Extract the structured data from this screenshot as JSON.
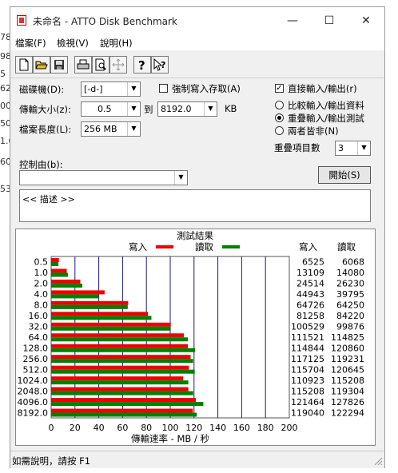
{
  "left_strip_numbers": [
    "78",
    "98",
    "5",
    "62",
    "00",
    "50",
    "1.0",
    "60",
    "53"
  ],
  "window": {
    "title": "未命名 - ATTO Disk Benchmark",
    "controls": {
      "minimize": "—",
      "maximize": "☐",
      "close": "✕"
    }
  },
  "menu": [
    "檔案(F)",
    "檢視(V)",
    "說明(H)"
  ],
  "toolbar_icons": [
    "new-icon",
    "open-icon",
    "save-icon",
    "print-icon",
    "print-preview-icon",
    "move-icon",
    "help-icon",
    "context-help-icon"
  ],
  "form": {
    "drive_label": "磁碟機(D):",
    "drive_value": "[-d-]",
    "force_write_label": "強制寫入存取(A)",
    "force_write_checked": false,
    "direct_io_label": "直接輸入/輸出(r)",
    "direct_io_checked": true,
    "transfer_label": "傳輸大小(z):",
    "transfer_from": "0.5",
    "to_label": "到",
    "transfer_to": "8192.0",
    "kb_label": "KB",
    "length_label": "檔案長度(L):",
    "length_value": "256 MB",
    "radio_compare": "比較輸入/輸出資料",
    "radio_overlap": "重疊輸入/輸出測試",
    "radio_neither": "兩者皆非(N)",
    "selected_radio": "radio_overlap",
    "queue_label": "重疊項目數",
    "queue_value": "3",
    "controlled_by_label": "控制由(b):",
    "controlled_by_value": "",
    "start_button": "開始(S)",
    "description": "<< 描述 >>"
  },
  "results": {
    "title": "測試結果",
    "legend_write": "寫入",
    "legend_read": "讀取",
    "col_write": "寫入",
    "col_read": "讀取",
    "write_values": [
      "6525",
      "13109",
      "24514",
      "44943",
      "64726",
      "81258",
      "100529",
      "111521",
      "114844",
      "117125",
      "115704",
      "110923",
      "115208",
      "121464",
      "119040"
    ],
    "read_values": [
      "6068",
      "14080",
      "26230",
      "39795",
      "64250",
      "84220",
      "99876",
      "114825",
      "120860",
      "119231",
      "120645",
      "115208",
      "119304",
      "127826",
      "122294"
    ]
  },
  "chart_data": {
    "type": "bar",
    "orientation": "horizontal",
    "categories": [
      "0.5",
      "1.0",
      "2.0",
      "4.0",
      "8.0",
      "16.0",
      "32.0",
      "64.0",
      "128.0",
      "256.0",
      "512.0",
      "1024.0",
      "2048.0",
      "4096.0",
      "8192.0"
    ],
    "series": [
      {
        "name": "寫入",
        "color": "#ee0000",
        "values": [
          6.5,
          13.1,
          24.5,
          44.9,
          64.7,
          81.3,
          100.5,
          111.5,
          114.8,
          117.1,
          115.7,
          110.9,
          115.2,
          121.5,
          119.0
        ]
      },
      {
        "name": "讀取",
        "color": "#008000",
        "values": [
          6.1,
          14.1,
          26.2,
          39.8,
          64.3,
          84.2,
          99.9,
          114.8,
          120.9,
          119.2,
          120.6,
          115.2,
          119.3,
          127.8,
          122.3
        ]
      }
    ],
    "xlabel": "傳輸速率 - MB / 秒",
    "xlim": [
      0,
      200
    ],
    "xticks": [
      "0",
      "20",
      "40",
      "60",
      "80",
      "100",
      "120",
      "140",
      "160",
      "180",
      "200"
    ],
    "grid": true,
    "grid_color": "#1a1a8c"
  },
  "status": "如需說明，請按 F1"
}
